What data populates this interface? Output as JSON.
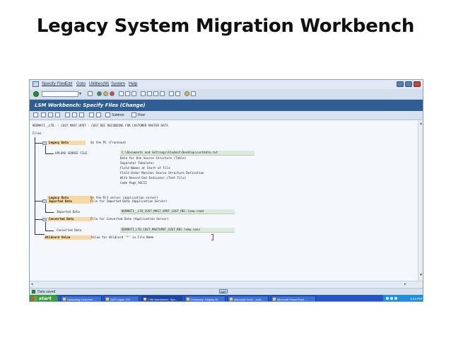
{
  "slide": {
    "title": "Legacy System Migration Workbench"
  },
  "window": {
    "menu": [
      "Specify Files",
      "Edit",
      "Goto",
      "Utilities(M)",
      "System",
      "Help"
    ],
    "title": "LSM Workbench: Specify Files (Change)",
    "app_toolbar": {
      "subtree_label": "Subtree",
      "row_label": "Row"
    }
  },
  "content": {
    "header_line": "NIRMATI__LTD. - CUST_MAST_UPDT - CUST_REC RECORDING FOR CUSTOMER MASTER DATA",
    "files_label": "Files",
    "legacy": {
      "tag": "Legacy Data",
      "desc": "On the PC (Frontend)",
      "upload_label": "UPLOAD SOURCE FILE",
      "upload_path": "C:\\Documents and Settings\\Student\\Desktop\\custdata.txt",
      "details": [
        "Data for One Source Structure (Table)",
        "Separator Tabulator",
        "Field Names at Start of File",
        "Field Order Matches Source Structure Definition",
        "With Record End Indicator (Text File)",
        "Code Page ASCII"
      ]
    },
    "legacy_server": {
      "tag": "Legacy Data",
      "desc": "On the R/3 server (application server)"
    },
    "imported": {
      "tag": "Imported Data",
      "desc": "File for Imported Data (Application Server)",
      "label": "Imported Data",
      "file": "NIRMATI__LTD_CUST_MAST_UPDT_CUST_REC.lsmw.read"
    },
    "converted": {
      "tag": "Converted Data",
      "desc": "File for Converted Data (Application Server)",
      "label": "Converted Data",
      "file": "NIRMATI_LTD_CUST_MASTUPDT_CUST_REC.lsmw.conv"
    },
    "wildcard": {
      "tag": "Wildcard Value",
      "desc": "Value for Wildcard '*' in File Name"
    }
  },
  "status": {
    "message": "Data saved",
    "sap_label": "SAP"
  },
  "taskbar": {
    "start": "start",
    "tasks": [
      "Uploading Customer ...",
      "SAP Logon 720",
      "LSM Workbench: Spe...",
      "Dictionary: Display St...",
      "Microsoft Excel - cust...",
      "Microsoft PowerPoint ..."
    ],
    "active_index": 2,
    "clock": "4:44 PM"
  },
  "colors": {
    "title_bar": "#2f5e95",
    "tag_fill": "#f6d9a6",
    "taskbar": "#2456c4",
    "start": "#3a9c3f"
  }
}
